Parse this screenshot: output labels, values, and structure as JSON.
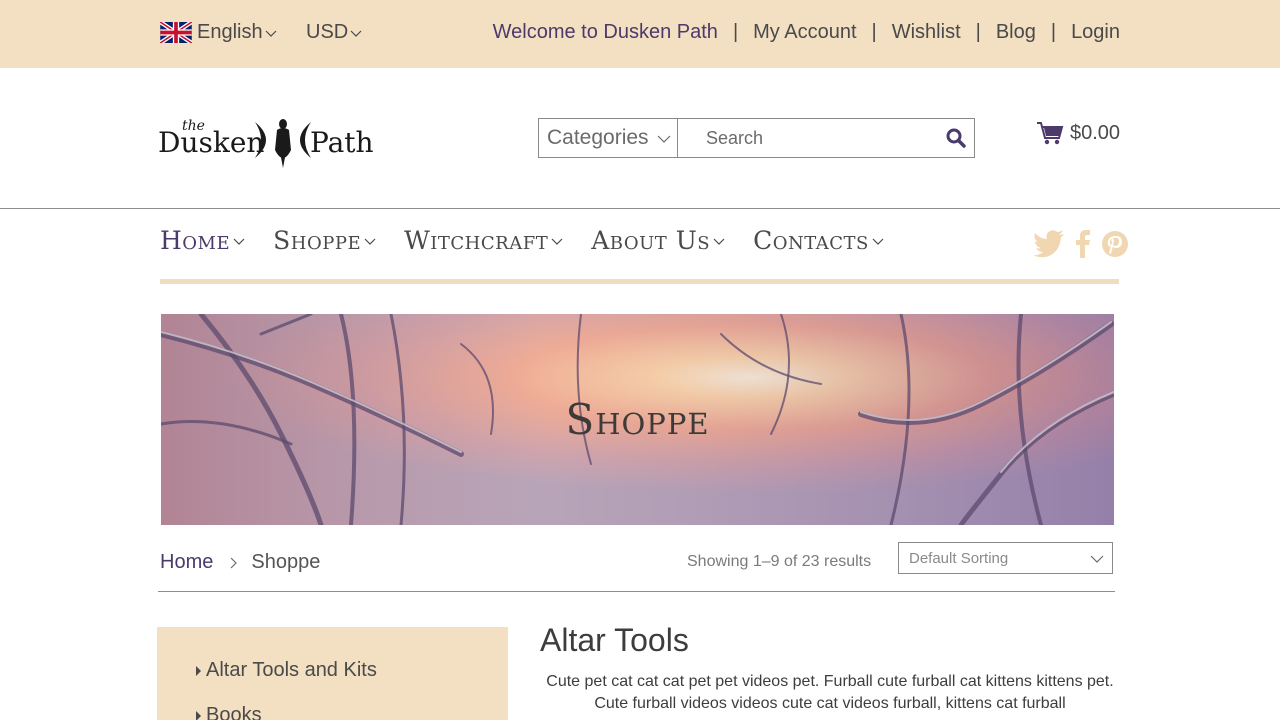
{
  "topbar": {
    "language": "English",
    "currency": "USD",
    "welcome": "Welcome to Dusken Path",
    "links": [
      "My Account",
      "Wishlist",
      "Blog",
      "Login"
    ],
    "separator": "|"
  },
  "header": {
    "logo_text": "the Dusken Path",
    "categories_label": "Categories",
    "search_placeholder": "Search",
    "cart_total": "$0.00"
  },
  "nav": {
    "items": [
      "Home",
      "Shoppe",
      "Witchcraft",
      "About Us",
      "Contacts"
    ],
    "social": [
      "twitter-icon",
      "facebook-icon",
      "pinterest-icon"
    ]
  },
  "banner": {
    "title": "Shoppe"
  },
  "breadcrumb": {
    "home": "Home",
    "current": "Shoppe"
  },
  "shop": {
    "result_count": "Showing 1–9 of 23 results",
    "sort_value": "Default Sorting"
  },
  "sidebar": {
    "items": [
      "Altar Tools and Kits",
      "Books"
    ]
  },
  "content": {
    "title": "Altar Tools",
    "description": "Cute pet cat cat cat pet pet videos pet. Furball cute furball cat kittens kittens pet. Cute furball videos videos cute cat videos furball, kittens cat furball"
  },
  "colors": {
    "topbar_bg": "#f3dfc1",
    "accent_purple": "#4b3a6b",
    "sidebar_bg": "#f3dfc1"
  }
}
